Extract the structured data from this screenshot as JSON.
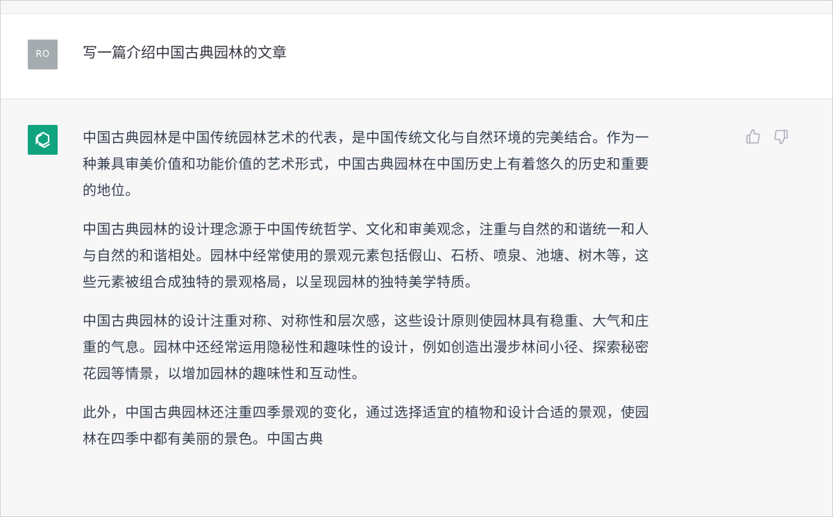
{
  "user_message": {
    "avatar_initials": "RO",
    "text": "写一篇介绍中国古典园林的文章"
  },
  "assistant_message": {
    "avatar_icon": "openai-logo-icon",
    "paragraphs": [
      {
        "lines": [
          "中国古典园林是中国传统园林艺术的代表，是中国传统文化与自然环境的完美结合。作为一",
          "种兼具审美价值和功能价值的艺术形式，中国古典园林在中国历史上有着悠久的历史和重要",
          "的地位。"
        ]
      },
      {
        "lines": [
          "中国古典园林的设计理念源于中国传统哲学、文化和审美观念，注重与自然的和谐统一和人",
          "与自然的和谐相处。园林中经常使用的景观元素包括假山、石桥、喷泉、池塘、树木等，这",
          "些元素被组合成独特的景观格局，以呈现园林的独特美学特质。"
        ]
      },
      {
        "lines": [
          "中国古典园林的设计注重对称、对称性和层次感，这些设计原则使园林具有稳重、大气和庄",
          "重的气息。园林中还经常运用隐秘性和趣味性的设计，例如创造出漫步林间小径、探索秘密",
          "花园等情景，以增加园林的趣味性和互动性。"
        ]
      },
      {
        "lines": [
          "此外，中国古典园林还注重四季景观的变化，通过选择适宜的植物和设计合适的景观，使园",
          "林在四季中都有美丽的景色。中国古典"
        ]
      }
    ]
  },
  "feedback": {
    "thumbs_up_icon": "thumbs-up-icon",
    "thumbs_down_icon": "thumbs-down-icon"
  },
  "colors": {
    "user_avatar_bg": "#a4acaf",
    "bot_avatar_bg": "#10a37f",
    "assistant_row_bg": "#f7f7f8",
    "user_row_bg": "#ffffff",
    "text": "#374151"
  }
}
